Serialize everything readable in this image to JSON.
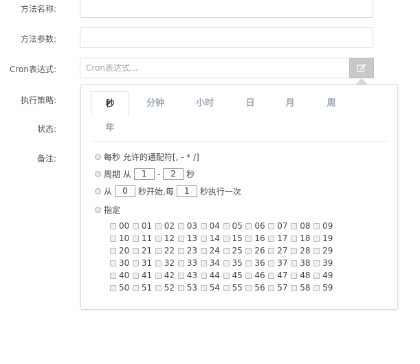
{
  "form": {
    "method_name_label": "方法名称:",
    "method_params_label": "方法参数:",
    "cron_label": "Cron表达式:",
    "cron_placeholder": "Cron表达式...",
    "strategy_label": "执行策略:",
    "status_label": "状态:",
    "remark_label": "备注:"
  },
  "cron_popover": {
    "tabs": [
      "秒",
      "分钟",
      "小时",
      "日",
      "月",
      "周",
      "年"
    ],
    "active_tab": "秒",
    "options": {
      "every_text": "每秒 允许的通配符[, - * /]",
      "period_prefix": "周期 从",
      "period_from": "1",
      "period_dash": "-",
      "period_to": "2",
      "period_suffix": "秒",
      "from_prefix": "从",
      "from_start": "0",
      "from_mid": "秒开始,每",
      "from_every": "1",
      "from_suffix": "秒执行一次",
      "specify_text": "指定"
    },
    "seconds": [
      "00",
      "01",
      "02",
      "03",
      "04",
      "05",
      "06",
      "07",
      "08",
      "09",
      "10",
      "11",
      "12",
      "13",
      "14",
      "15",
      "16",
      "17",
      "18",
      "19",
      "20",
      "21",
      "22",
      "23",
      "24",
      "25",
      "26",
      "27",
      "28",
      "29",
      "30",
      "31",
      "32",
      "33",
      "34",
      "35",
      "36",
      "37",
      "38",
      "39",
      "40",
      "41",
      "42",
      "43",
      "44",
      "45",
      "46",
      "47",
      "48",
      "49",
      "50",
      "51",
      "52",
      "53",
      "54",
      "55",
      "56",
      "57",
      "58",
      "59"
    ]
  }
}
